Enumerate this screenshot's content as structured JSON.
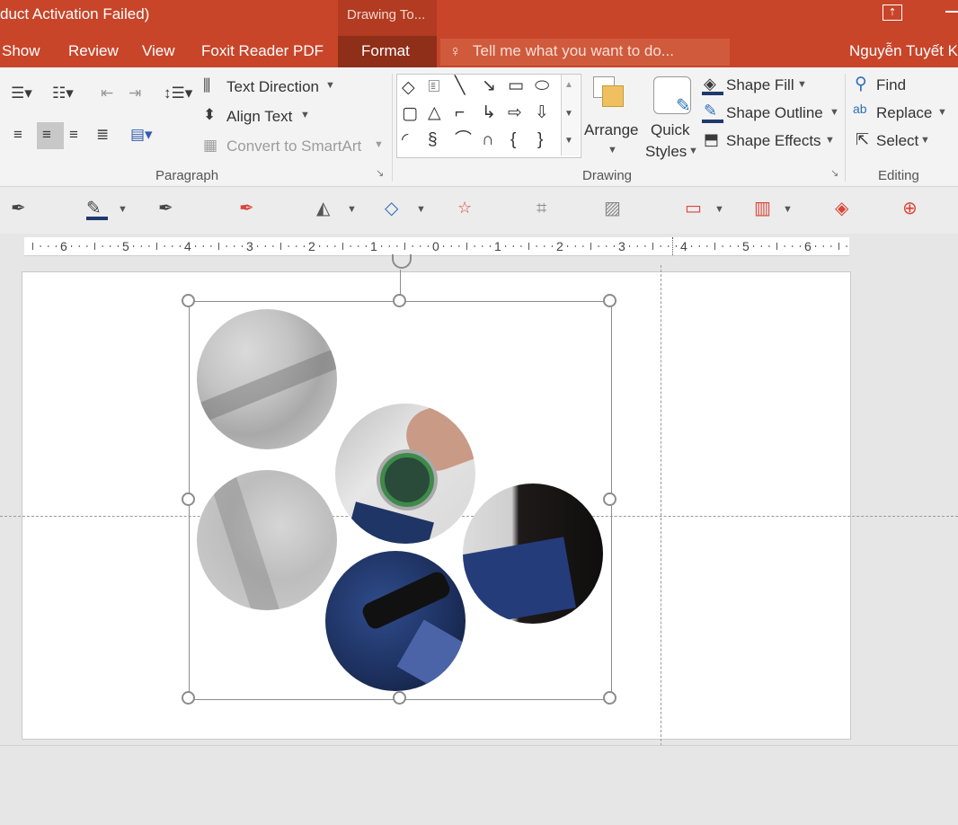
{
  "window": {
    "title": "duct Activation Failed)",
    "contextual_group": "Drawing To...",
    "user": "Nguyễn Tuyết K"
  },
  "tabs": [
    {
      "label": "Show"
    },
    {
      "label": "Review"
    },
    {
      "label": "View"
    },
    {
      "label": "Foxit Reader PDF"
    },
    {
      "label": "Format",
      "active": true
    }
  ],
  "tell_me": {
    "placeholder": "Tell me what you want to do..."
  },
  "ribbon": {
    "paragraph": {
      "group_label": "Paragraph",
      "text_direction": "Text Direction",
      "align_text": "Align Text",
      "convert_smartart": "Convert to SmartArt"
    },
    "drawing": {
      "group_label": "Drawing",
      "arrange": "Arrange",
      "quick": "Quick",
      "styles": "Styles",
      "shape_fill": "Shape Fill",
      "shape_outline": "Shape Outline",
      "shape_effects": "Shape Effects"
    },
    "editing": {
      "group_label": "Editing",
      "find": "Find",
      "replace": "Replace",
      "select": "Select"
    }
  },
  "ruler": {
    "labels": [
      "6",
      "5",
      "4",
      "3",
      "2",
      "1",
      "0",
      "1",
      "2",
      "3",
      "4",
      "5",
      "6"
    ]
  },
  "colors": {
    "titlebar": "#c8452a",
    "ribbon": "#f3f3f3",
    "accent_blue": "#1e3a6e",
    "toolbar_red": "#d9463a"
  },
  "icons": [
    "bullets-icon",
    "numbering-icon",
    "decrease-indent-icon",
    "increase-indent-icon",
    "line-spacing-icon",
    "align-left-icon",
    "align-center-icon",
    "align-right-icon",
    "justify-icon",
    "columns-icon",
    "eyedropper-icon",
    "pen-color-icon",
    "star-icon",
    "layers-icon",
    "target-icon"
  ]
}
